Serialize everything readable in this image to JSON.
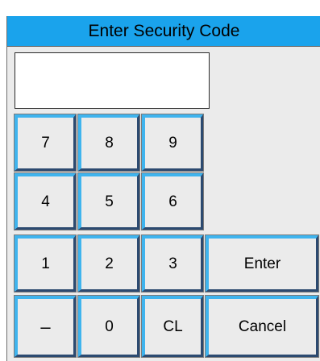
{
  "dialog": {
    "title": "Enter Security Code",
    "code_value": ""
  },
  "keypad": {
    "row1": [
      "7",
      "8",
      "9"
    ],
    "row2": [
      "4",
      "5",
      "6"
    ],
    "row3": [
      "1",
      "2",
      "3"
    ],
    "row4": [
      "–",
      "0",
      "CL"
    ]
  },
  "actions": {
    "enter_label": "Enter",
    "cancel_label": "Cancel"
  },
  "colors": {
    "title_bar": "#1aa3ec",
    "key_highlight": "#3fb4ee",
    "key_shadow": "#2c4a70",
    "panel": "#ebebeb"
  }
}
